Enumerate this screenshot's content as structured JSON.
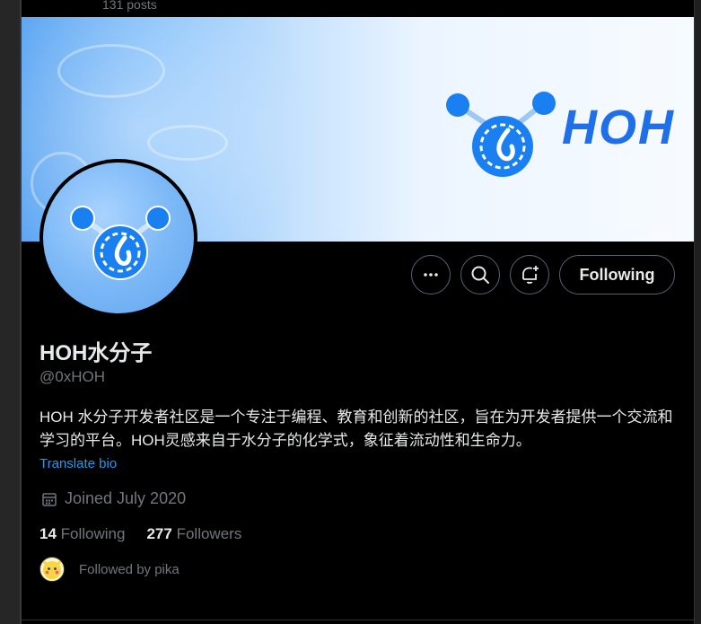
{
  "header": {
    "post_count": "131 posts"
  },
  "banner": {
    "brand_text": "HOH"
  },
  "profile": {
    "name": "HOH水分子",
    "handle": "@0xHOH",
    "bio": "HOH 水分子开发者社区是一个专注于编程、教育和创新的社区，旨在为开发者提供一个交流和学习的平台。HOH灵感来自于水分子的化学式，象征着流动性和生命力。",
    "translate_label": "Translate bio",
    "joined": "Joined July 2020"
  },
  "actions": {
    "more_icon": "more-icon",
    "search_icon": "search-icon",
    "notify_icon": "bell-plus-icon",
    "following_label": "Following"
  },
  "stats": {
    "following_count": "14",
    "following_label": "Following",
    "followers_count": "277",
    "followers_label": "Followers"
  },
  "followed_by": {
    "text": "Followed by pika"
  },
  "colors": {
    "accent": "#1d9bf0",
    "brand": "#1f6fe8",
    "muted": "#71767b",
    "text": "#e7e9ea"
  }
}
